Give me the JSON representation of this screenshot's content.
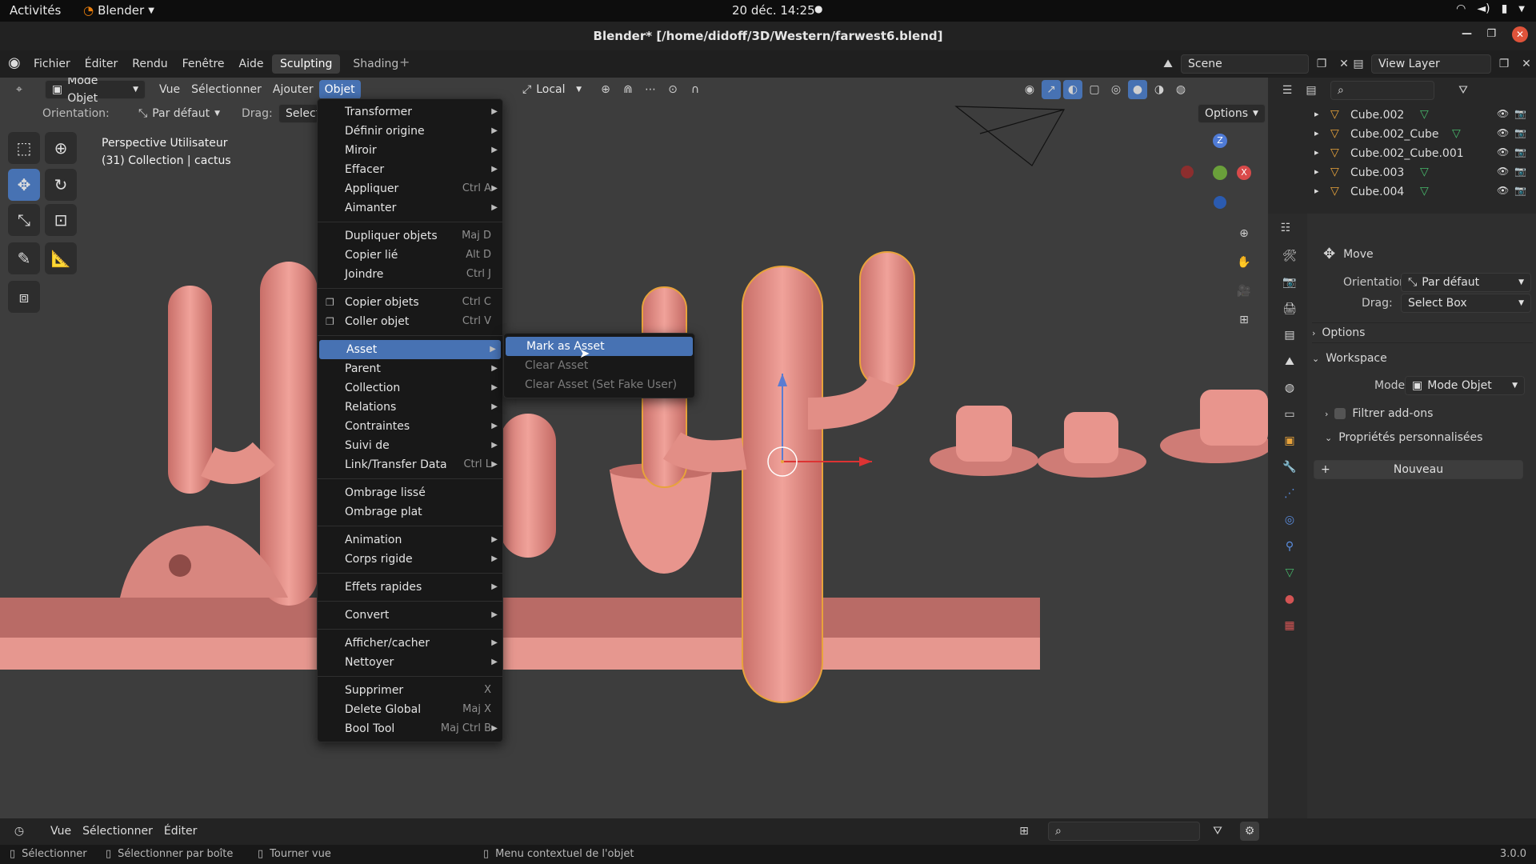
{
  "gnome": {
    "activities": "Activités",
    "app": "Blender",
    "app_icon": "blender-icon",
    "datetime": "20 déc.  14:25"
  },
  "window": {
    "title": "Blender* [/home/didoff/3D/Western/farwest6.blend]"
  },
  "topbar": {
    "menus": [
      "Fichier",
      "Éditer",
      "Rendu",
      "Fenêtre",
      "Aide"
    ],
    "workspaces": [
      "Sculpting",
      "Shading"
    ],
    "active_workspace": "Sculpting",
    "add_workspace": "+",
    "scene": "Scene",
    "view_layer": "View Layer"
  },
  "viewport": {
    "mode": "Mode Objet",
    "menus": [
      "Vue",
      "Sélectionner",
      "Ajouter",
      "Objet"
    ],
    "active_menu": "Objet",
    "transform_space": "Local",
    "orientation_label": "Orientation:",
    "orientation_value": "Par défaut",
    "drag_label": "Drag:",
    "drag_value": "Select",
    "options": "Options",
    "view_name": "Perspective Utilisateur",
    "collection_info": "(31) Collection | cactus"
  },
  "object_menu": {
    "groups": [
      [
        {
          "label": "Transformer",
          "sub": true
        },
        {
          "label": "Définir origine",
          "sub": true
        },
        {
          "label": "Miroir",
          "sub": true
        },
        {
          "label": "Effacer",
          "sub": true
        },
        {
          "label": "Appliquer",
          "shortcut": "Ctrl A",
          "sub": true
        },
        {
          "label": "Aimanter",
          "sub": true
        }
      ],
      [
        {
          "label": "Dupliquer objets",
          "shortcut": "Maj D"
        },
        {
          "label": "Copier lié",
          "shortcut": "Alt D"
        },
        {
          "label": "Joindre",
          "shortcut": "Ctrl J"
        }
      ],
      [
        {
          "label": "Copier objets",
          "shortcut": "Ctrl C",
          "icon": "copy-icon"
        },
        {
          "label": "Coller objet",
          "shortcut": "Ctrl V",
          "icon": "paste-icon"
        }
      ],
      [
        {
          "label": "Asset",
          "sub": true,
          "highlight": true
        },
        {
          "label": "Parent",
          "sub": true
        },
        {
          "label": "Collection",
          "sub": true
        },
        {
          "label": "Relations",
          "sub": true
        },
        {
          "label": "Contraintes",
          "sub": true
        },
        {
          "label": "Suivi de",
          "sub": true
        },
        {
          "label": "Link/Transfer Data",
          "shortcut": "Ctrl L",
          "sub": true
        }
      ],
      [
        {
          "label": "Ombrage lissé"
        },
        {
          "label": "Ombrage plat"
        }
      ],
      [
        {
          "label": "Animation",
          "sub": true
        },
        {
          "label": "Corps rigide",
          "sub": true
        }
      ],
      [
        {
          "label": "Effets rapides",
          "sub": true
        }
      ],
      [
        {
          "label": "Convert",
          "sub": true
        }
      ],
      [
        {
          "label": "Afficher/cacher",
          "sub": true
        },
        {
          "label": "Nettoyer",
          "sub": true
        }
      ],
      [
        {
          "label": "Supprimer",
          "shortcut": "X"
        },
        {
          "label": "Delete Global",
          "shortcut": "Maj X"
        },
        {
          "label": "Bool Tool",
          "shortcut": "Maj Ctrl B",
          "sub": true
        }
      ]
    ]
  },
  "asset_submenu": {
    "items": [
      "Mark as Asset",
      "Clear Asset",
      "Clear Asset (Set Fake User)"
    ]
  },
  "outliner": {
    "items": [
      "Cube.002",
      "Cube.002_Cube",
      "Cube.002_Cube.001",
      "Cube.003",
      "Cube.004"
    ]
  },
  "properties": {
    "tool_name": "Move",
    "orientation_label": "Orientation",
    "orientation_value": "Par défaut",
    "drag_label": "Drag:",
    "drag_value": "Select Box",
    "options_panel": "Options",
    "workspace_panel": "Workspace",
    "mode_label": "Mode",
    "mode_value": "Mode Objet",
    "filter_addons": "Filtrer add-ons",
    "custom_props": "Propriétés personnalisées",
    "new_button": "Nouveau"
  },
  "timeline": {
    "menus": [
      "Vue",
      "Sélectionner",
      "Éditer"
    ]
  },
  "status": {
    "select": "Sélectionner",
    "box_select": "Sélectionner par boîte",
    "rotate": "Tourner vue",
    "context": "Menu contextuel de l'objet",
    "version": "3.0.0"
  },
  "colors": {
    "accent": "#4772b3",
    "mesh": "#e8938b",
    "selection": "#e8a33b"
  }
}
